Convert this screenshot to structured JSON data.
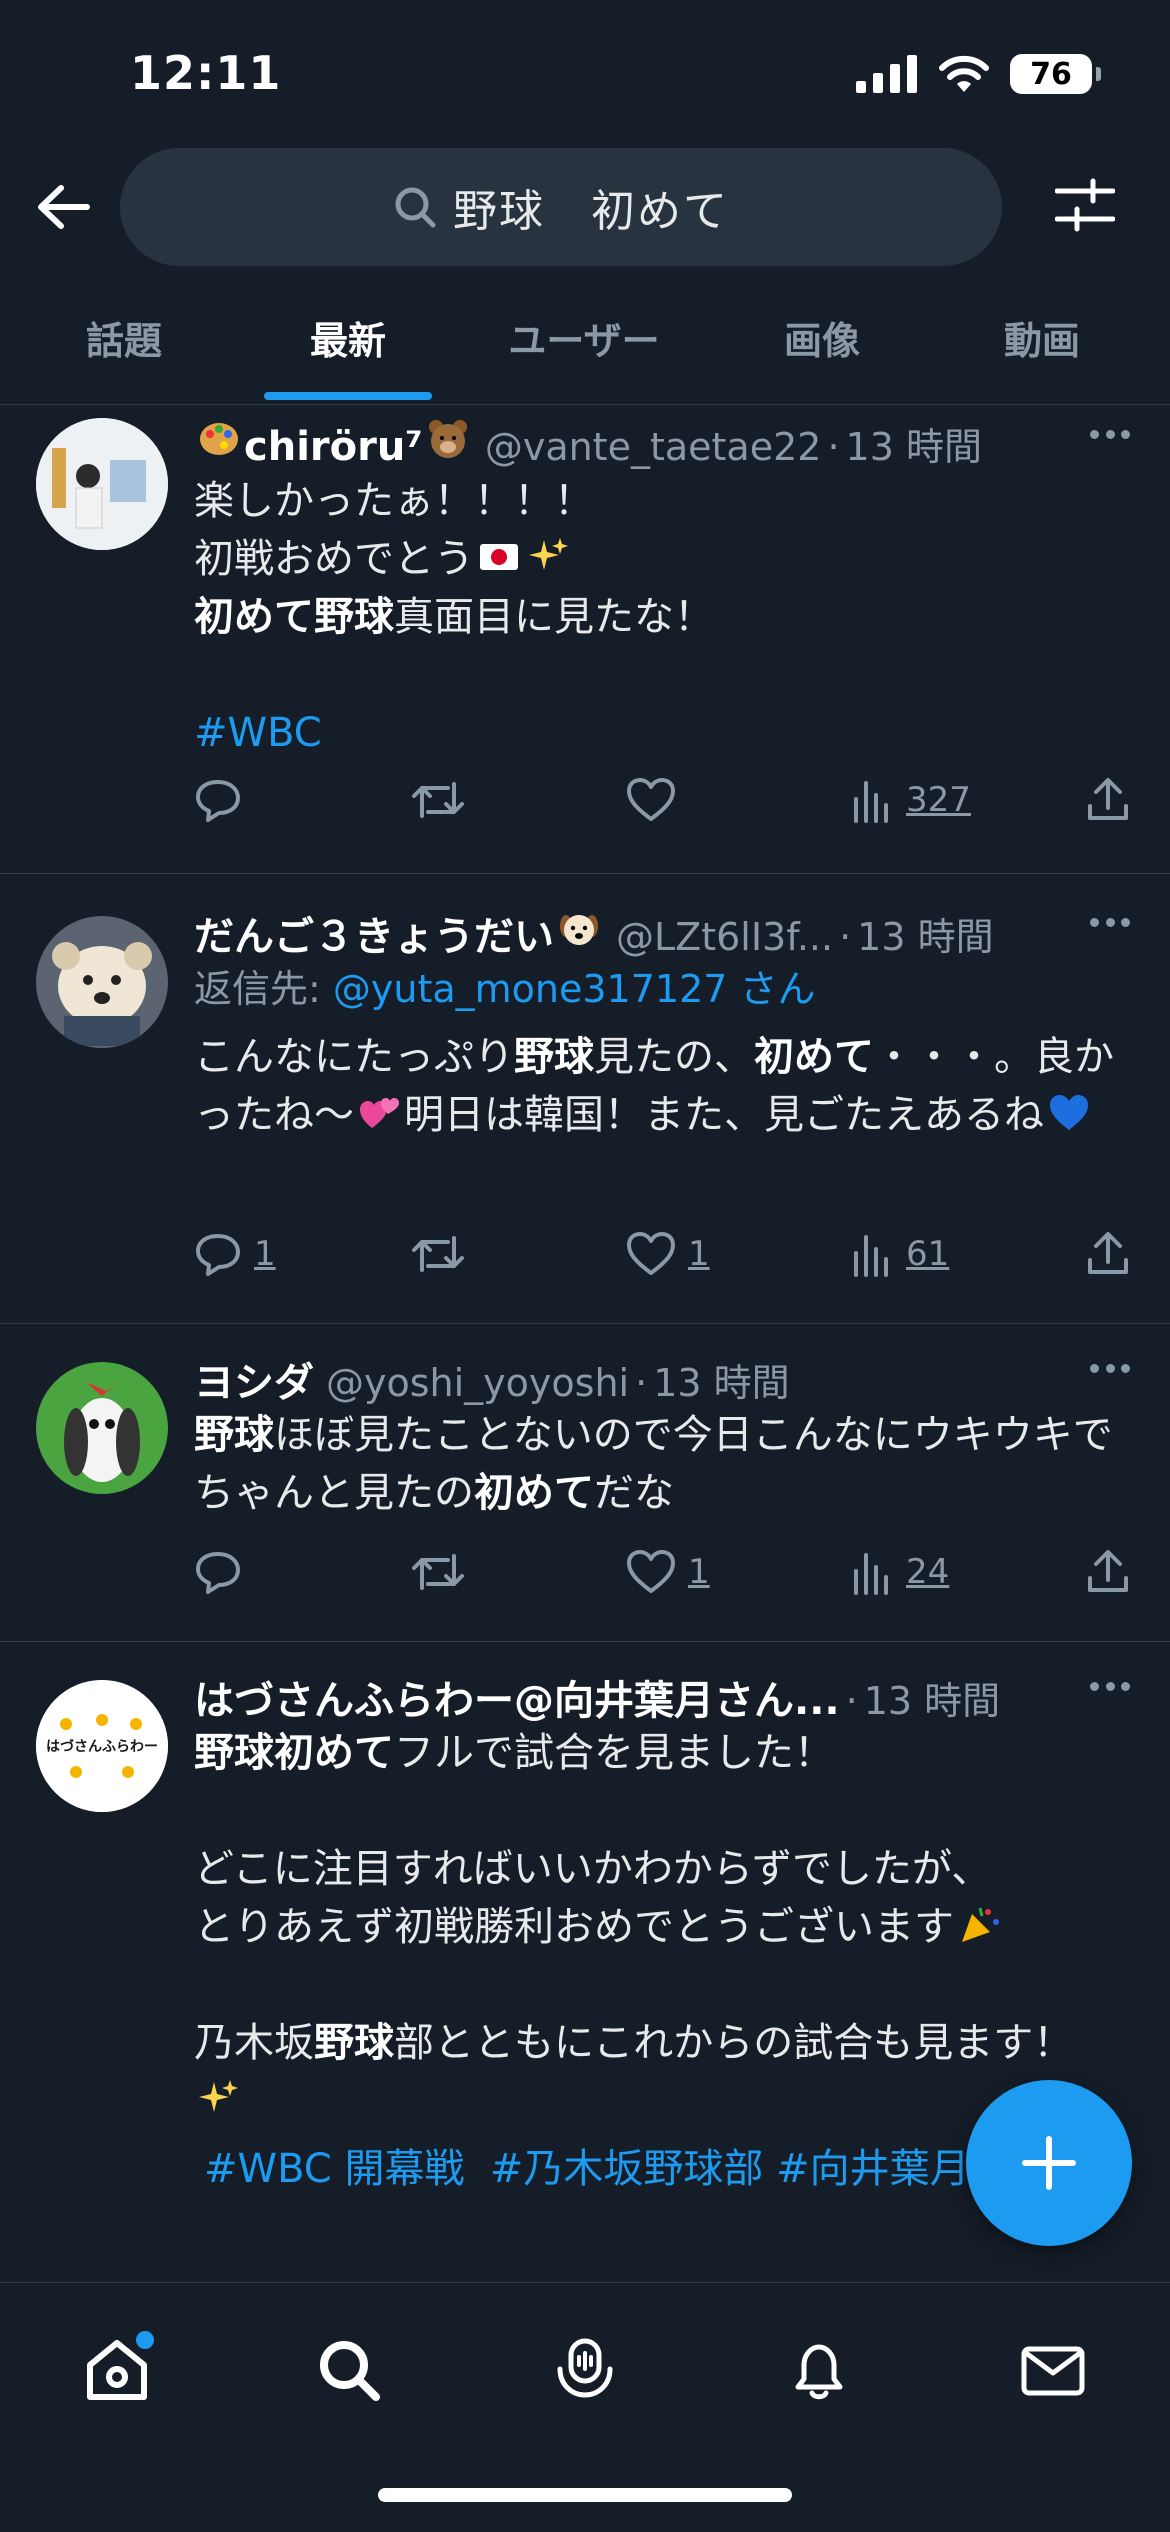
{
  "status_bar": {
    "time": "12:11",
    "battery": "76"
  },
  "search": {
    "query": "野球　初めて"
  },
  "tabs": [
    {
      "label": "話題"
    },
    {
      "label": "最新"
    },
    {
      "label": "ユーザー"
    },
    {
      "label": "画像"
    },
    {
      "label": "動画"
    }
  ],
  "active_tab": "最新",
  "tweets": [
    {
      "name": "chiröru⁷",
      "handle": "@vante_taetae22",
      "time": "13 時間",
      "body_line1": "楽しかったぁ！！！！",
      "body_line2": "初戦おめでとう",
      "body_line3_bold": "初めて野球",
      "body_line3_rest": "真面目に見たな！",
      "hashtag": "#WBC",
      "replies": "",
      "retweets": "",
      "likes": "",
      "views": "327"
    },
    {
      "name": "だんご３きょうだい",
      "handle": "@LZt6lI3f...",
      "time": "13 時間",
      "reply_prefix": "返信先: ",
      "reply_handle": "@yuta_mone317127 さん",
      "body_a": "こんなにたっぷり",
      "body_b_bold": "野球",
      "body_c": "見たの、",
      "body_d_bold": "初めて",
      "body_e": "・・・。良かったね〜",
      "body_f": "明日は韓国！また、見ごたえあるね",
      "replies": "1",
      "retweets": "",
      "likes": "1",
      "views": "61"
    },
    {
      "name": "ヨシダ",
      "handle": "@yoshi_yoyoshi",
      "time": "13 時間",
      "body_a_bold": "野球",
      "body_b": "ほぼ見たことないので今日こんなにウキウキでちゃんと見たの",
      "body_c_bold": "初めて",
      "body_d": "だな",
      "replies": "",
      "retweets": "",
      "likes": "1",
      "views": "24"
    },
    {
      "name": "はづさんふらわー@向井葉月さん...",
      "time": "13 時間",
      "avatar_text": "はづさんふらわー",
      "body_a_bold": "野球初めて",
      "body_b": "フルで試合を見ました！",
      "body_c": "どこに注目すればいいかわからずでしたが、",
      "body_d": "とりあえず初戦勝利おめでとうございます",
      "body_e": "乃木坂",
      "body_f_bold": "野球",
      "body_g": "部とともにこれからの試合も見ます！",
      "hashtags": "#WBC 開幕戦  #乃木坂野球部 #向井葉月"
    }
  ],
  "colors": {
    "background": "#151d28",
    "accent": "#1d9bf0",
    "muted": "#8b98a5",
    "search_bg": "#283340"
  }
}
